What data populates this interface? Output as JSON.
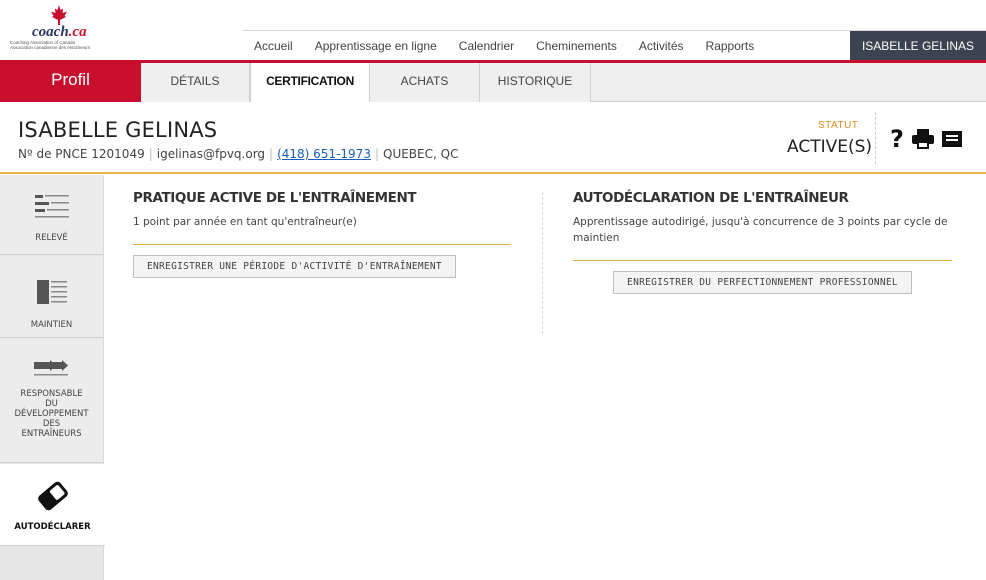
{
  "logo": {
    "brand": "coach",
    "brand_dot": ".ca",
    "tagline_1": "Coaching Association of Canada",
    "tagline_2": "Association canadienne des entraîneurs"
  },
  "nav": {
    "items": [
      "Accueil",
      "Apprentissage en ligne",
      "Calendrier",
      "Cheminements",
      "Activités",
      "Rapports"
    ],
    "user": "ISABELLE GELINAS"
  },
  "profile_tab": "Profil",
  "subtabs": [
    "DÉTAILS",
    "CERTIFICATION",
    "ACHATS",
    "HISTORIQUE"
  ],
  "active_subtab": "CERTIFICATION",
  "header": {
    "name": "ISABELLE GELINAS",
    "pnce_label": "Nº de PNCE",
    "pnce": "1201049",
    "email": "igelinas@fpvq.org",
    "phone": "(418) 651-1973",
    "location": "QUEBEC, QC",
    "statut_label": "STATUT",
    "statut_value": "ACTIVE(S)",
    "help_icon": "?"
  },
  "sidebar": {
    "items": [
      {
        "label": "RELEVÉ",
        "icon": "list-icon"
      },
      {
        "label": "MAINTIEN",
        "icon": "doc-lines-icon"
      },
      {
        "label": "RESPONSABLE DU DÉVELOPPEMENT DES ENTRAÎNEURS",
        "label_lines": [
          "RESPONSABLE",
          "DU",
          "DÉVELOPPEMENT",
          "DES",
          "ENTRAÎNEURS"
        ],
        "icon": "arrows-icon"
      },
      {
        "label": "AUTODÉCLARER",
        "icon": "eraser-icon"
      }
    ]
  },
  "left_col": {
    "title": "PRATIQUE ACTIVE DE L'ENTRAÎNEMENT",
    "desc": "1 point par année en tant qu'entraîneur(e)",
    "button": "ENREGISTRER UNE PÉRIODE D'ACTIVITÉ D'ENTRAÎNEMENT"
  },
  "right_col": {
    "title": "AUTODÉCLARATION DE L'ENTRAÎNEUR",
    "desc": "Apprentissage autodirigé, jusqu'à concurrence de 3 points par cycle de maintien",
    "button": "ENREGISTRER DU PERFECTIONNEMENT PROFESSIONNEL"
  },
  "colors": {
    "brand_red": "#c8102e",
    "accent_gold": "#e8b54a",
    "status_orange": "#e08a1e",
    "link_blue": "#1a5fb4",
    "user_bar": "#3b4450"
  }
}
